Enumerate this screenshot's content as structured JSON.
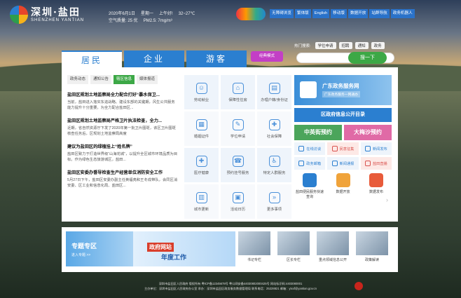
{
  "header": {
    "logo_cn": "深圳·盐田",
    "logo_en": "SHENZHEN YANTIAN",
    "date": "2020年6月1日",
    "weekday": "星期一",
    "time_period": "上午好!",
    "temp": "32~27℃",
    "aqi": "空气质量: 25 优",
    "pm": "PM2.5: 7mg/m³"
  },
  "toplinks": [
    "无障碍浏览",
    "繁体版",
    "English",
    "移动版",
    "数据开放",
    "站群导航",
    "政务机器人"
  ],
  "tabs": [
    "居民",
    "企业",
    "游客"
  ],
  "old_mode": "经典模式",
  "hot": {
    "label": "热门搜索:",
    "terms": [
      "学位申请",
      "招聘",
      "通知",
      "政务"
    ]
  },
  "search": {
    "placeholder": "",
    "button": "搜一下"
  },
  "news_tabs": [
    "政务动态",
    "通知公告",
    "辖区信息",
    "媒体报道"
  ],
  "news": [
    {
      "title": "盐田区规划土地监察局全力配合打好“暴水保卫...",
      "body": "当前，盐田进入落实东进战略、建设东部的关键期，风生公共服务能力提升十分重要。为全力配合盐田区..."
    },
    {
      "title": "盐田区规划土地监察局严格卫片执法检查，全力...",
      "body": "近期，省自然资源厅下发了2020年第一批卫片图斑，该区卫片图斑核查任务后，区规划土地监察局高度"
    },
    {
      "title": "建议为盐田区的绿植挂上“姓名牌”",
      "body": "盐田区致力于打造世界级“山海花城”，以提升全区城市环境品质为目标。作为绿色生态旅游城区，盐田..."
    },
    {
      "title": "盐田区安委办督导检查生产经营单位消防安全工作",
      "body": "5月27日下午，盐田区安委办副主任黄福亮和王冬成带队，会同区消安委、区工业和信息化局、盐田区..."
    }
  ],
  "services": [
    {
      "label": "劳动就业",
      "icon": "worker-icon"
    },
    {
      "label": "保障性住房",
      "icon": "house-icon"
    },
    {
      "label": "办理户籍/身份证",
      "icon": "id-icon"
    },
    {
      "label": "婚姻证件",
      "icon": "certificate-icon"
    },
    {
      "label": "学位申请",
      "icon": "graduation-icon"
    },
    {
      "label": "社会保障",
      "icon": "shield-icon"
    },
    {
      "label": "医疗健康",
      "icon": "medical-icon"
    },
    {
      "label": "预约挂号服务",
      "icon": "phone-icon"
    },
    {
      "label": "特定人群服务",
      "icon": "people-icon"
    },
    {
      "label": "城市更新",
      "icon": "city-icon"
    },
    {
      "label": "活动日历",
      "icon": "calendar-icon"
    },
    {
      "label": "更多事项",
      "icon": "more-icon"
    }
  ],
  "right": {
    "gd_title": "广东政务服务网",
    "gd_sub": "广东政务服务一网通办",
    "info_bar": "区政府信息公开目录",
    "pair": [
      "中英街预约",
      "大梅沙预约"
    ],
    "minis": [
      {
        "label": "在线访谈",
        "style": "blue"
      },
      {
        "label": "民意征集",
        "style": "red"
      },
      {
        "label": "新闻发布",
        "style": "blue"
      },
      {
        "label": "政务邮箱",
        "style": "blue"
      },
      {
        "label": "新闻通报",
        "style": "blue"
      },
      {
        "label": "盐田直播",
        "style": "red"
      }
    ],
    "icons": [
      {
        "label": "盐田便民服务快速查询",
        "color": "#2b7fd0"
      },
      {
        "label": "数据开放",
        "color": "#f0a33a"
      },
      {
        "label": "数据发布",
        "color": "#e85b3a"
      }
    ]
  },
  "strip": {
    "zt_title": "专题专区",
    "zt_sub": "进入专题 >>",
    "gov_title": "政府网站",
    "gov_sub": "年度工作",
    "specials": [
      "书记专栏",
      "区长专栏",
      "重点领域信息公开",
      "政策解读"
    ]
  },
  "footer": {
    "line1": "深圳市盐田区人民政府 版权所有  粤ICP备12345678号  粤公网安备44030802000425号  网站标识码:4403080001",
    "line2": "主办单位：深圳市盐田区人民政府办公室 承办：深圳市盐田区政务服务数据管理局 联系电话：25228821 邮箱：ytxxf@yantian.gov.cn"
  }
}
